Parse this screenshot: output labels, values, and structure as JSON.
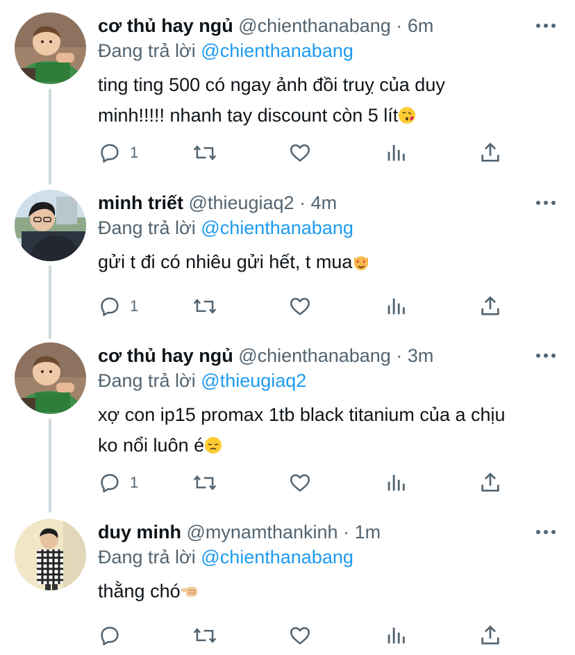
{
  "colors": {
    "text": "#0f1419",
    "secondary": "#536471",
    "link": "#1d9bf0",
    "thread_line": "#cfd9de"
  },
  "reply_prefix": "Đang trả lời",
  "tweets": [
    {
      "name": "cơ thủ hay ngủ",
      "handle": "@chienthanabang",
      "separator": "·",
      "time": "6m",
      "replying_to": "@chienthanabang",
      "lines": [
        "ting ting 500 có ngay ảnh đồi truỵ của duy",
        "minh!!!!! nhanh tay discount còn 5 lít"
      ],
      "emoji": "face-blowing-kiss-emoji",
      "reply_count": "1",
      "avatar": "toddler-avatar"
    },
    {
      "name": "minh triết",
      "handle": "@thieugiaq2",
      "separator": "·",
      "time": "4m",
      "replying_to": "@chienthanabang",
      "lines": [
        "gửi t đi có nhiêu gửi hết, t mua"
      ],
      "emoji": "smiling-cat-heart-eyes-emoji",
      "reply_count": "1",
      "avatar": "young-man-glasses-avatar"
    },
    {
      "name": "cơ thủ hay ngủ",
      "handle": "@chienthanabang",
      "separator": "·",
      "time": "3m",
      "replying_to": "@thieugiaq2",
      "lines": [
        "xợ con ip15 promax 1tb black titanium của a chịu",
        "ko nổi luôn é"
      ],
      "emoji": "disappointed-face-emoji",
      "reply_count": "1",
      "avatar": "toddler-avatar"
    },
    {
      "name": "duy minh",
      "handle": "@mynamthankinh",
      "separator": "·",
      "time": "1m",
      "replying_to": "@chienthanabang",
      "lines": [
        "thằng chó"
      ],
      "emoji": "backhand-index-pointing-left-emoji",
      "reply_count": "",
      "avatar": "man-plaid-shirt-avatar"
    }
  ]
}
